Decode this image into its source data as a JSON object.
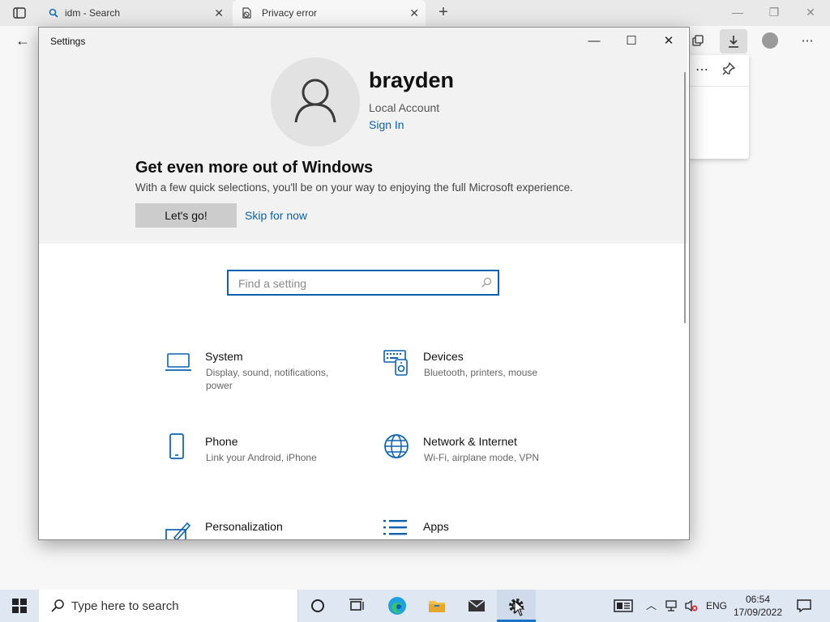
{
  "browser": {
    "tabs": [
      {
        "title": "idm - Search",
        "icon": "search-icon"
      },
      {
        "title": "Privacy error",
        "icon": "warning-icon"
      }
    ],
    "new_tab_label": "+"
  },
  "settings": {
    "window_title": "Settings",
    "user": {
      "name": "brayden",
      "account_type": "Local Account",
      "sign_in_label": "Sign In"
    },
    "promo": {
      "title": "Get even more out of Windows",
      "text": "With a few quick selections, you'll be on your way to enjoying the full Microsoft experience.",
      "primary_button": "Let's go!",
      "secondary_link": "Skip for now"
    },
    "search": {
      "placeholder": "Find a setting"
    },
    "categories": [
      {
        "title": "System",
        "description": "Display, sound, notifications, power",
        "icon": "laptop-icon"
      },
      {
        "title": "Devices",
        "description": "Bluetooth, printers, mouse",
        "icon": "devices-icon"
      },
      {
        "title": "Phone",
        "description": "Link your Android, iPhone",
        "icon": "phone-icon"
      },
      {
        "title": "Network & Internet",
        "description": "Wi-Fi, airplane mode, VPN",
        "icon": "globe-icon"
      },
      {
        "title": "Personalization",
        "description": "",
        "icon": "personalization-icon"
      },
      {
        "title": "Apps",
        "description": "",
        "icon": "apps-icon"
      }
    ]
  },
  "taskbar": {
    "search_placeholder": "Type here to search",
    "language": "ENG",
    "time": "06:54",
    "date": "17/09/2022"
  },
  "colors": {
    "accent": "#0a62b0",
    "taskbar": "#dfe7f2",
    "hero_bg": "#f2f2f2"
  }
}
